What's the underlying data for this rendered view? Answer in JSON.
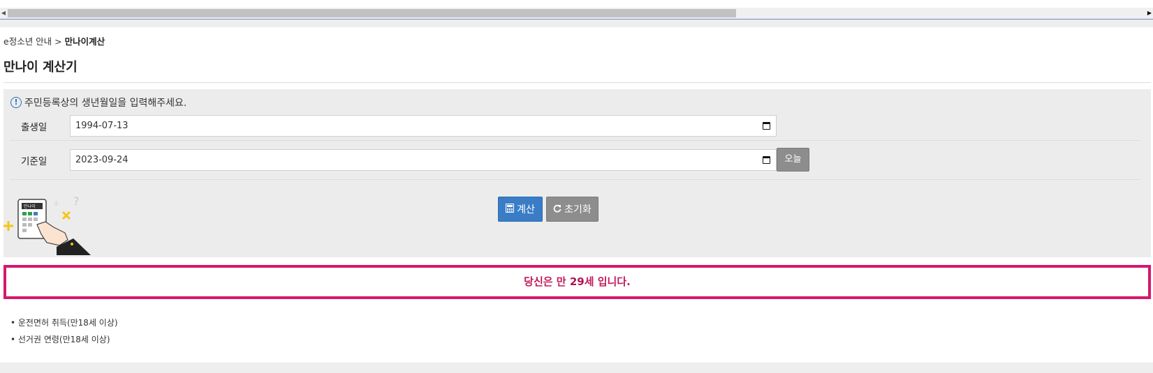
{
  "breadcrumb": {
    "parent": "e정소년 안내",
    "separator": ">",
    "current": "만나이계산"
  },
  "page_title": "만나이 계산기",
  "form": {
    "notice": "주민등록상의 생년월일을 입력해주세요.",
    "birth_label": "출생일",
    "birth_value": "1994-07-13",
    "base_label": "기준일",
    "base_value": "2023-09-24",
    "today_button": "오늘",
    "calc_button": "계산",
    "reset_button": "초기화",
    "illustration_label": "만나이"
  },
  "result": {
    "prefix": "당신은 만 ",
    "age": "29",
    "suffix": "세 입니다."
  },
  "notes": [
    "• 운전면허 취득(만18세 이상)",
    "• 선거권 연령(만18세 이상)"
  ],
  "colors": {
    "result_border": "#d4186c",
    "calc_button": "#3a7dc6",
    "gray_button": "#8d8d8d",
    "info_icon": "#2a6ebf"
  },
  "icons": [
    "info-icon",
    "calendar-icon",
    "calculator-icon",
    "refresh-icon"
  ]
}
